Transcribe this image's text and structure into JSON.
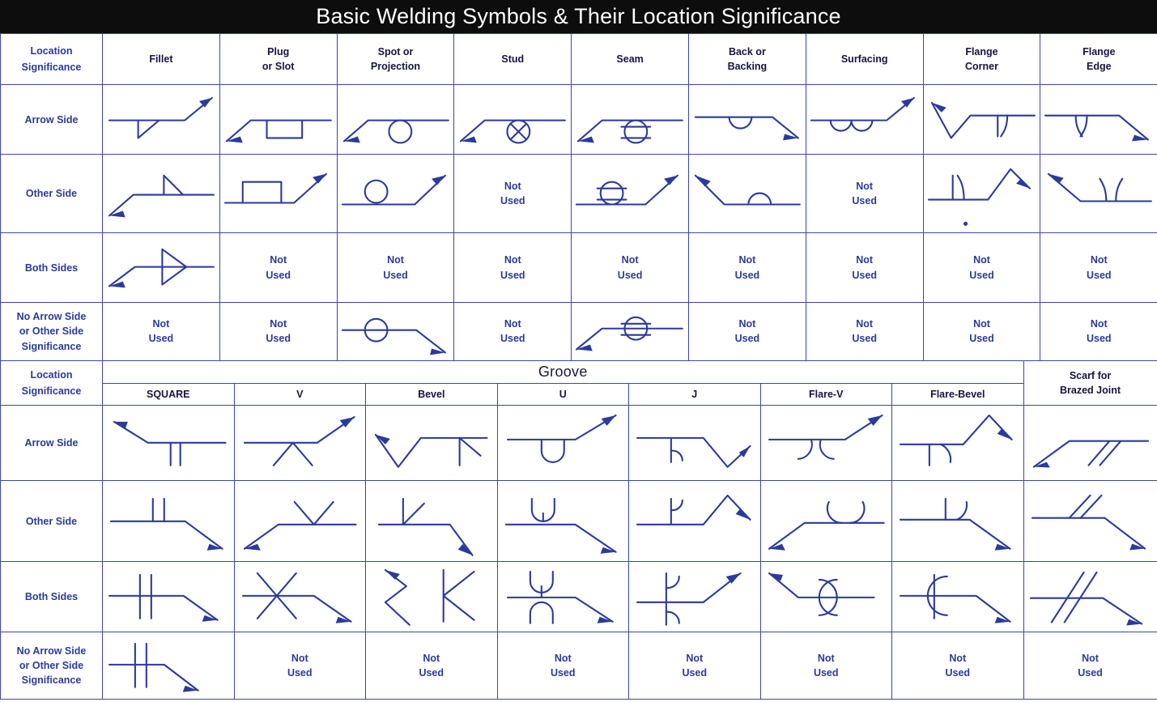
{
  "title": "Basic Welding Symbols & Their Location Significance",
  "colors": {
    "header_green": "#dfe85c",
    "line_blue": "#2b3a9b",
    "title_bar": "#0d0d0d",
    "title_text": "#ffffff",
    "grid_border": "#3a47a8"
  },
  "corner_label": {
    "line1": "Location",
    "line2": "Significance"
  },
  "not_used": {
    "line1": "Not",
    "line2": "Used"
  },
  "row_labels": {
    "arrow_side": "Arrow Side",
    "other_side": "Other Side",
    "both_sides": "Both Sides",
    "no_significance_l1": "No Arrow Side",
    "no_significance_l2": "or Other Side",
    "no_significance_l3": "Significance"
  },
  "table_basic": {
    "columns": [
      {
        "l1": "Fillet",
        "l2": ""
      },
      {
        "l1": "Plug",
        "l2": "or Slot"
      },
      {
        "l1": "Spot or",
        "l2": "Projection"
      },
      {
        "l1": "Stud",
        "l2": ""
      },
      {
        "l1": "Seam",
        "l2": ""
      },
      {
        "l1": "Back or",
        "l2": "Backing"
      },
      {
        "l1": "Surfacing",
        "l2": ""
      },
      {
        "l1": "Flange",
        "l2": "Corner"
      },
      {
        "l1": "Flange",
        "l2": "Edge"
      }
    ],
    "rows": [
      {
        "label": "Arrow Side",
        "cells": [
          "symbol",
          "symbol",
          "symbol",
          "symbol",
          "symbol",
          "symbol",
          "symbol",
          "symbol",
          "symbol"
        ]
      },
      {
        "label": "Other Side",
        "cells": [
          "symbol",
          "symbol",
          "symbol",
          "not-used",
          "symbol",
          "symbol",
          "not-used",
          "symbol",
          "symbol"
        ]
      },
      {
        "label": "Both Sides",
        "cells": [
          "symbol",
          "not-used",
          "not-used",
          "not-used",
          "not-used",
          "not-used",
          "not-used",
          "not-used",
          "not-used"
        ]
      },
      {
        "label": "No Arrow Side or Other Side Significance",
        "cells": [
          "not-used",
          "not-used",
          "symbol",
          "not-used",
          "symbol",
          "not-used",
          "not-used",
          "not-used",
          "not-used"
        ]
      }
    ]
  },
  "table_groove": {
    "group_label": "Groove",
    "scarf": {
      "l1": "Scarf for",
      "l2": "Brazed Joint"
    },
    "columns": [
      {
        "l1": "SQUARE"
      },
      {
        "l1": "V"
      },
      {
        "l1": "Bevel"
      },
      {
        "l1": "U"
      },
      {
        "l1": "J"
      },
      {
        "l1": "Flare-V"
      },
      {
        "l1": "Flare-Bevel"
      }
    ],
    "rows": [
      {
        "label": "Arrow Side",
        "cells": [
          "symbol",
          "symbol",
          "symbol",
          "symbol",
          "symbol",
          "symbol",
          "symbol",
          "symbol"
        ]
      },
      {
        "label": "Other Side",
        "cells": [
          "symbol",
          "symbol",
          "symbol",
          "symbol",
          "symbol",
          "symbol",
          "symbol",
          "symbol"
        ]
      },
      {
        "label": "Both Sides",
        "cells": [
          "symbol",
          "symbol",
          "symbol",
          "symbol",
          "symbol",
          "symbol",
          "symbol",
          "symbol"
        ]
      },
      {
        "label": "No Arrow Side or Other Side Significance",
        "cells": [
          "symbol",
          "not-used",
          "not-used",
          "not-used",
          "not-used",
          "not-used",
          "not-used",
          "not-used"
        ]
      }
    ]
  }
}
